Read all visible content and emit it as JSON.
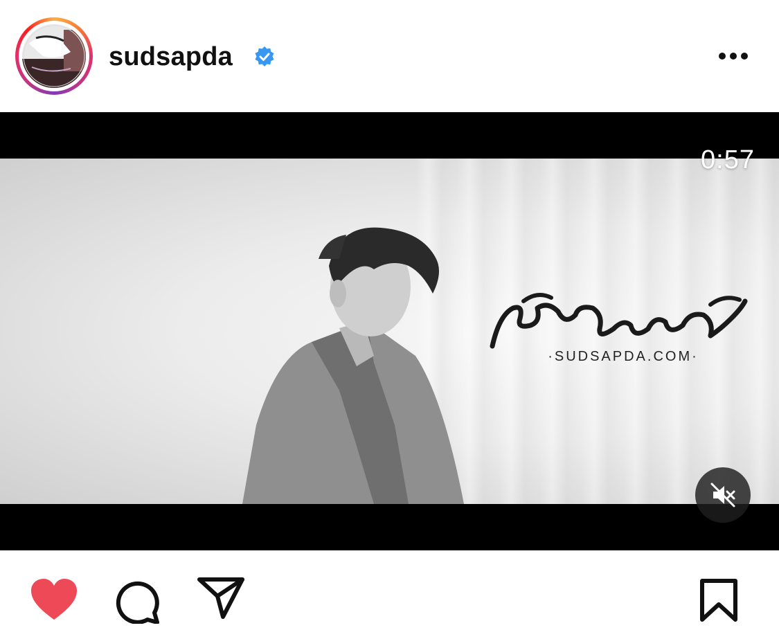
{
  "post": {
    "username": "sudsapda",
    "verified": true,
    "avatar_icon": "profile-avatar",
    "more_icon": "more-horizontal-icon"
  },
  "video": {
    "duration": "0:57",
    "muted": true,
    "mute_icon": "speaker-muted-icon",
    "logo_script_text": "สุดสัปดาห์",
    "logo_url_text": "·SUDSAPDA.COM·"
  },
  "actions": {
    "like_icon": "heart-filled-icon",
    "like_color": "#ed4956",
    "comment_icon": "comment-icon",
    "share_icon": "send-icon",
    "save_icon": "bookmark-icon"
  }
}
